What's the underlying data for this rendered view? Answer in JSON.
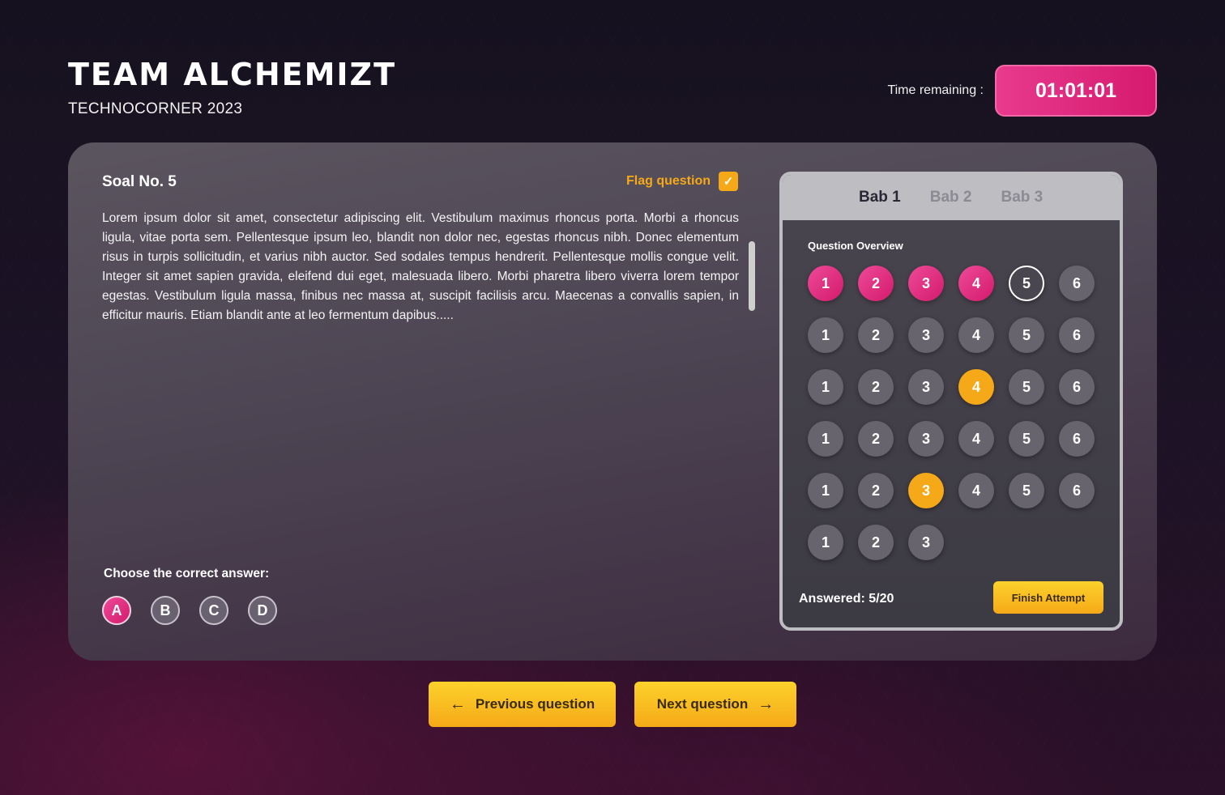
{
  "header": {
    "title": "TEAM ALCHEMIZT",
    "subtitle": "TECHNOCORNER 2023",
    "timer_label": "Time remaining :",
    "timer_value": "01:01:01"
  },
  "question": {
    "title": "Soal No. 5",
    "flag_label": "Flag question",
    "flag_checked": true,
    "text": "Lorem ipsum dolor sit amet, consectetur adipiscing elit. Vestibulum maximus rhoncus porta. Morbi a rhoncus ligula, vitae porta sem. Pellentesque ipsum leo, blandit non dolor nec, egestas rhoncus nibh. Donec elementum risus in turpis sollicitudin, et varius nibh auctor. Sed sodales tempus hendrerit. Pellentesque mollis congue velit. Integer sit amet sapien gravida, eleifend dui eget, malesuada libero. Morbi pharetra libero viverra lorem tempor egestas. Vestibulum ligula massa, finibus nec massa at, suscipit facilisis arcu. Maecenas a convallis sapien, in efficitur mauris. Etiam blandit ante at leo fermentum dapibus.....",
    "answer_label": "Choose the correct answer:",
    "options": [
      "A",
      "B",
      "C",
      "D"
    ],
    "selected_option": "A"
  },
  "overview": {
    "tabs": [
      "Bab 1",
      "Bab 2",
      "Bab 3"
    ],
    "active_tab": "Bab 1",
    "title": "Question Overview",
    "rows": [
      [
        {
          "label": "1",
          "state": "answered"
        },
        {
          "label": "2",
          "state": "answered"
        },
        {
          "label": "3",
          "state": "answered"
        },
        {
          "label": "4",
          "state": "answered"
        },
        {
          "label": "5",
          "state": "current"
        },
        {
          "label": "6",
          "state": "default"
        }
      ],
      [
        {
          "label": "1",
          "state": "default"
        },
        {
          "label": "2",
          "state": "default"
        },
        {
          "label": "3",
          "state": "default"
        },
        {
          "label": "4",
          "state": "default"
        },
        {
          "label": "5",
          "state": "default"
        },
        {
          "label": "6",
          "state": "default"
        }
      ],
      [
        {
          "label": "1",
          "state": "default"
        },
        {
          "label": "2",
          "state": "default"
        },
        {
          "label": "3",
          "state": "default"
        },
        {
          "label": "4",
          "state": "flagged"
        },
        {
          "label": "5",
          "state": "default"
        },
        {
          "label": "6",
          "state": "default"
        }
      ],
      [
        {
          "label": "1",
          "state": "default"
        },
        {
          "label": "2",
          "state": "default"
        },
        {
          "label": "3",
          "state": "default"
        },
        {
          "label": "4",
          "state": "default"
        },
        {
          "label": "5",
          "state": "default"
        },
        {
          "label": "6",
          "state": "default"
        }
      ],
      [
        {
          "label": "1",
          "state": "default"
        },
        {
          "label": "2",
          "state": "default"
        },
        {
          "label": "3",
          "state": "flagged"
        },
        {
          "label": "4",
          "state": "default"
        },
        {
          "label": "5",
          "state": "default"
        },
        {
          "label": "6",
          "state": "default"
        }
      ],
      [
        {
          "label": "1",
          "state": "default"
        },
        {
          "label": "2",
          "state": "default"
        },
        {
          "label": "3",
          "state": "default"
        }
      ]
    ],
    "answered_text": "Answered: 5/20",
    "finish_label": "Finish Attempt"
  },
  "navigation": {
    "prev_label": "Previous question",
    "next_label": "Next question",
    "prev_icon": "arrow-left-icon",
    "next_icon": "arrow-right-icon"
  },
  "colors": {
    "accent_pink": "#e0267c",
    "accent_orange": "#f6a918",
    "button_yellow": "#fcd22b"
  }
}
